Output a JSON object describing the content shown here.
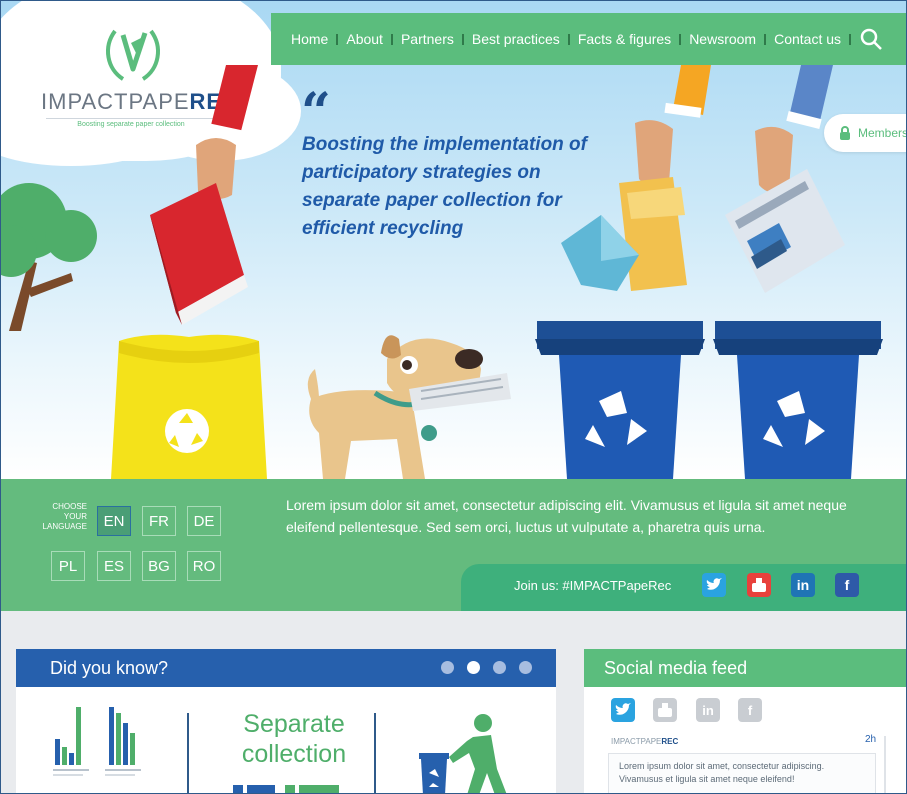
{
  "nav": {
    "items": [
      "Home",
      "About",
      "Partners",
      "Best practices",
      "Facts & figures",
      "Newsroom",
      "Contact us"
    ]
  },
  "logo": {
    "name_light": "IMPACTPAPE",
    "name_bold": "REC",
    "tagline": "Boosting separate paper collection"
  },
  "hero": {
    "quote_mark": "“",
    "quote": "Boosting the implementation of participatory strategies on separate paper collection for efficient recycling",
    "members_label": "Members"
  },
  "language": {
    "label": "CHOOSE YOUR LANGUAGE",
    "options": [
      "EN",
      "FR",
      "DE",
      "PL",
      "ES",
      "BG",
      "RO"
    ],
    "selected": "EN"
  },
  "band": {
    "text": "Lorem ipsum dolor sit amet, consectetur adipiscing elit. Vivamusus et ligula sit amet neque eleifend pellentesque. Sed sem orci, luctus ut vulputate a, pharetra quis urna.",
    "join_label": "Join us:  #IMPACTPapeRec",
    "social": [
      "twitter-icon",
      "youtube-icon",
      "linkedin-icon",
      "facebook-icon"
    ]
  },
  "did_you_know": {
    "title": "Did you know?",
    "slide_heading": "Separate collection",
    "dots": 4,
    "active_dot": 1
  },
  "social_feed": {
    "title": "Social media feed",
    "post_author_light": "IMPACTPAPE",
    "post_author_bold": "REC",
    "post_time": "2h",
    "post_text": "Lorem ipsum dolor sit amet, consectetur adipiscing. Vivamusus et ligula sit amet neque eleifend!"
  },
  "colors": {
    "green": "#64bb7e",
    "navy": "#1f4f8a",
    "blue_header": "#2660ad"
  }
}
